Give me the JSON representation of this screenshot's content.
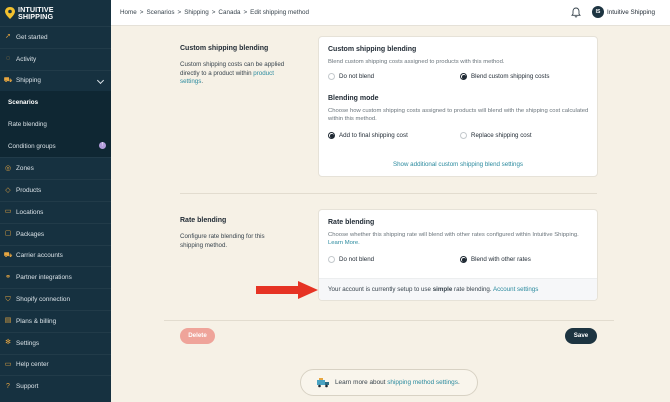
{
  "brand": {
    "line1": "INTUITIVE",
    "line2": "SHIPPING"
  },
  "sidebar": {
    "items": [
      {
        "label": "Get started",
        "icon": "rocket-icon"
      },
      {
        "label": "Activity",
        "icon": "activity-icon"
      },
      {
        "label": "Shipping",
        "icon": "shipping-icon",
        "expanded": true
      },
      {
        "label": "Zones",
        "icon": "zones-icon"
      },
      {
        "label": "Products",
        "icon": "products-icon"
      },
      {
        "label": "Locations",
        "icon": "locations-icon"
      },
      {
        "label": "Packages",
        "icon": "packages-icon"
      },
      {
        "label": "Carrier accounts",
        "icon": "carrier-icon"
      },
      {
        "label": "Partner integrations",
        "icon": "integrations-icon"
      },
      {
        "label": "Shopify connection",
        "icon": "shopify-icon"
      },
      {
        "label": "Plans & billing",
        "icon": "billing-icon"
      },
      {
        "label": "Settings",
        "icon": "gear-icon"
      },
      {
        "label": "Help center",
        "icon": "help-icon"
      },
      {
        "label": "Support",
        "icon": "support-icon"
      }
    ],
    "shipping_sub": [
      {
        "label": "Scenarios",
        "current": true
      },
      {
        "label": "Rate blending",
        "current": false
      },
      {
        "label": "Condition groups",
        "current": false
      }
    ]
  },
  "header": {
    "breadcrumb": [
      "Home",
      ">",
      "Scenarios",
      ">",
      "Shipping",
      ">",
      "Canada",
      ">",
      "Edit shipping method"
    ],
    "avatar_initials": "IS",
    "user_name": "Intuitive Shipping"
  },
  "custom_blending": {
    "section_title": "Custom shipping blending",
    "section_desc": "Custom shipping costs can be applied directly to a product within",
    "section_link": "product settings",
    "section_desc_end": ".",
    "card_title": "Custom shipping blending",
    "card_desc": "Blend custom shipping costs assigned to products with this method.",
    "option_a": "Do not blend",
    "option_b": "Blend custom shipping costs",
    "mode_title": "Blending mode",
    "mode_desc": "Choose how custom shipping costs assigned to products will blend with the shipping cost calculated within this method.",
    "mode_a": "Add to final shipping cost",
    "mode_b": "Replace shipping cost",
    "show_more": "Show additional custom shipping blend settings"
  },
  "rate_blending": {
    "section_title": "Rate blending",
    "section_desc": "Configure rate blending for this shipping method.",
    "card_title": "Rate blending",
    "card_desc": "Choose whether this shipping rate will blend with other rates configured within Intuitive Shipping.",
    "learn_more": "Learn More.",
    "option_a": "Do not blend",
    "option_b": "Blend with other rates",
    "note_pre": "Your account is currently setup to use",
    "note_bold": "simple",
    "note_post": "rate blending.",
    "note_link": "Account settings"
  },
  "actions": {
    "delete": "Delete",
    "save": "Save"
  },
  "learn": {
    "text": "Learn more about",
    "link": "shipping method settings",
    "end": "."
  },
  "colors": {
    "sidebar_bg": "#163140",
    "accent_icon": "#e7a640",
    "link": "#2a8a9e",
    "save_bg": "#1d3441",
    "delete_bg": "#efa49a",
    "arrow": "#e63323",
    "page_bg": "#f6f1e6"
  }
}
